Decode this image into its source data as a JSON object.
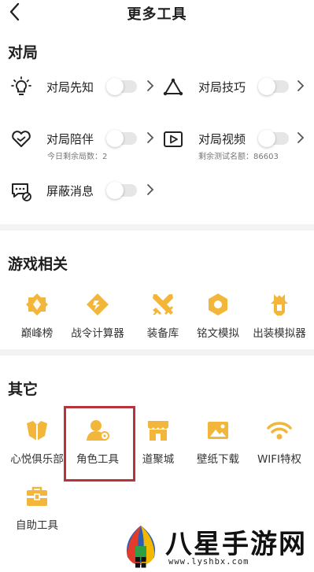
{
  "header": {
    "title": "更多工具"
  },
  "sections": {
    "match": "对局",
    "game": "游戏相关",
    "other": "其它"
  },
  "match_items": [
    {
      "label": "对局先知",
      "icon": "lightbulb-icon"
    },
    {
      "label": "对局技巧",
      "icon": "triangle-nodes-icon"
    },
    {
      "label": "对局陪伴",
      "icon": "heart-icon",
      "sub": "今日剩余局数：2"
    },
    {
      "label": "对局视频",
      "icon": "video-play-icon",
      "sub": "剩余测试名额：86603"
    },
    {
      "label": "屏蔽消息",
      "icon": "message-block-icon"
    }
  ],
  "game_items": [
    {
      "label": "巅峰榜",
      "icon": "peak-rank-icon"
    },
    {
      "label": "战令计算器",
      "icon": "battle-pass-calculator-icon"
    },
    {
      "label": "装备库",
      "icon": "equipment-swords-icon"
    },
    {
      "label": "铭文模拟",
      "icon": "inscription-icon"
    },
    {
      "label": "出装模拟器",
      "icon": "build-simulator-icon"
    }
  ],
  "other_items": [
    {
      "label": "心悦俱乐部",
      "icon": "club-icon"
    },
    {
      "label": "角色工具",
      "icon": "role-tool-icon"
    },
    {
      "label": "道聚城",
      "icon": "store-icon"
    },
    {
      "label": "壁纸下载",
      "icon": "wallpaper-icon"
    },
    {
      "label": "WIFI特权",
      "icon": "wifi-icon"
    },
    {
      "label": "自助工具",
      "icon": "toolbox-icon"
    }
  ],
  "watermark": {
    "text": "八星手游网",
    "url": "www.lyshbx.com"
  },
  "colors": {
    "accent_gold": "#f2b73a",
    "highlight_red": "#b8343a",
    "band_gray": "#f3f3f3"
  }
}
